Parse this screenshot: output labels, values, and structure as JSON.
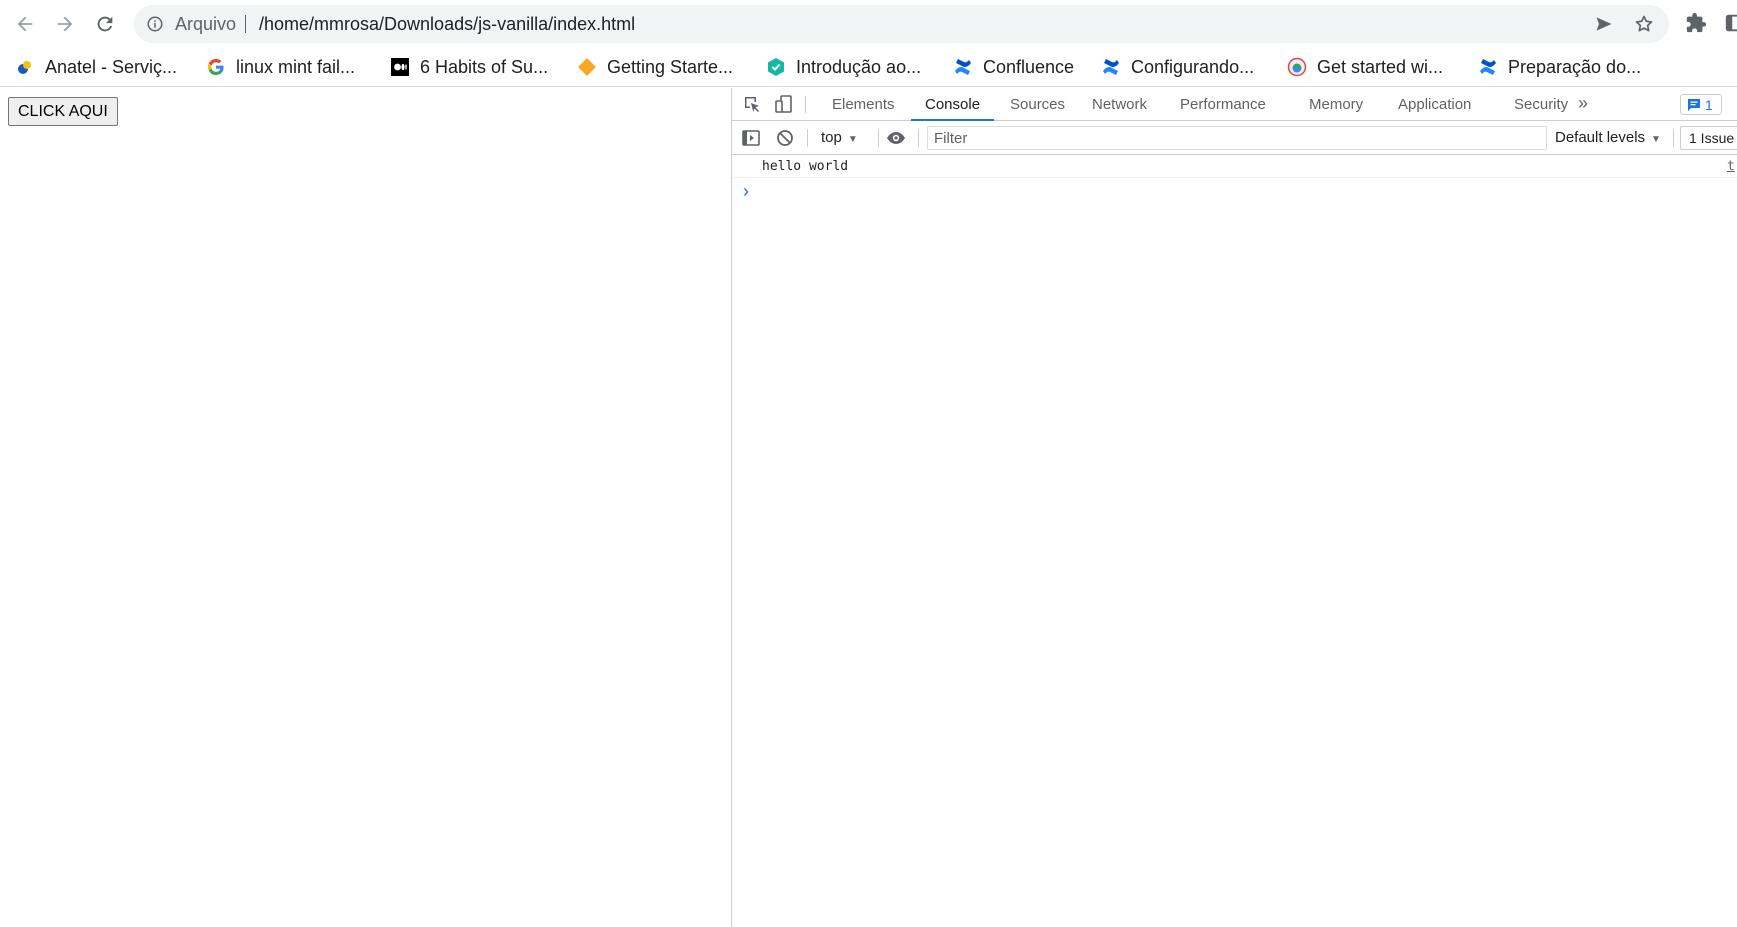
{
  "toolbar": {
    "url_scheme": "Arquivo",
    "url_path": "/home/mmrosa/Downloads/js-vanilla/index.html",
    "icons": [
      "back-arrow-icon",
      "forward-arrow-icon",
      "reload-icon",
      "info-icon",
      "send-icon",
      "star-icon",
      "extensions-puzzle-icon",
      "side-panel-icon"
    ]
  },
  "bookmarks": [
    {
      "label": "Anatel - Serviç...",
      "icon": "anatel-favicon"
    },
    {
      "label": "linux mint fail...",
      "icon": "google-favicon"
    },
    {
      "label": "6 Habits of Su...",
      "icon": "medium-favicon"
    },
    {
      "label": "Getting Starte...",
      "icon": "diamond-favicon"
    },
    {
      "label": "Introdução ao...",
      "icon": "hexagon-favicon"
    },
    {
      "label": "Confluence",
      "icon": "confluence-favicon"
    },
    {
      "label": "Configurando...",
      "icon": "confluence-favicon"
    },
    {
      "label": "Get started wi...",
      "icon": "globe-favicon"
    },
    {
      "label": "Preparação do...",
      "icon": "confluence-favicon"
    }
  ],
  "page": {
    "button_label": "CLICK AQUI"
  },
  "devtools": {
    "tabs": [
      {
        "label": "Elements",
        "active": false
      },
      {
        "label": "Console",
        "active": true
      },
      {
        "label": "Sources",
        "active": false
      },
      {
        "label": "Network",
        "active": false
      },
      {
        "label": "Performance",
        "active": false
      },
      {
        "label": "Memory",
        "active": false
      },
      {
        "label": "Application",
        "active": false
      },
      {
        "label": "Security",
        "active": false
      }
    ],
    "more_tabs": "»",
    "issues_badge_count": "1",
    "console": {
      "context": "top",
      "filter_placeholder": "Filter",
      "levels": "Default levels",
      "issues_button": "1 Issue",
      "logs": [
        {
          "message": "hello world",
          "source": "t"
        }
      ],
      "prompt": "›"
    }
  },
  "colors": {
    "accent": "#1a73e8",
    "omnibox_bg": "#f1f3f4",
    "border": "#cbcdd1",
    "text": "#202124",
    "muted": "#5f6368",
    "confluence": "#2684ff"
  }
}
